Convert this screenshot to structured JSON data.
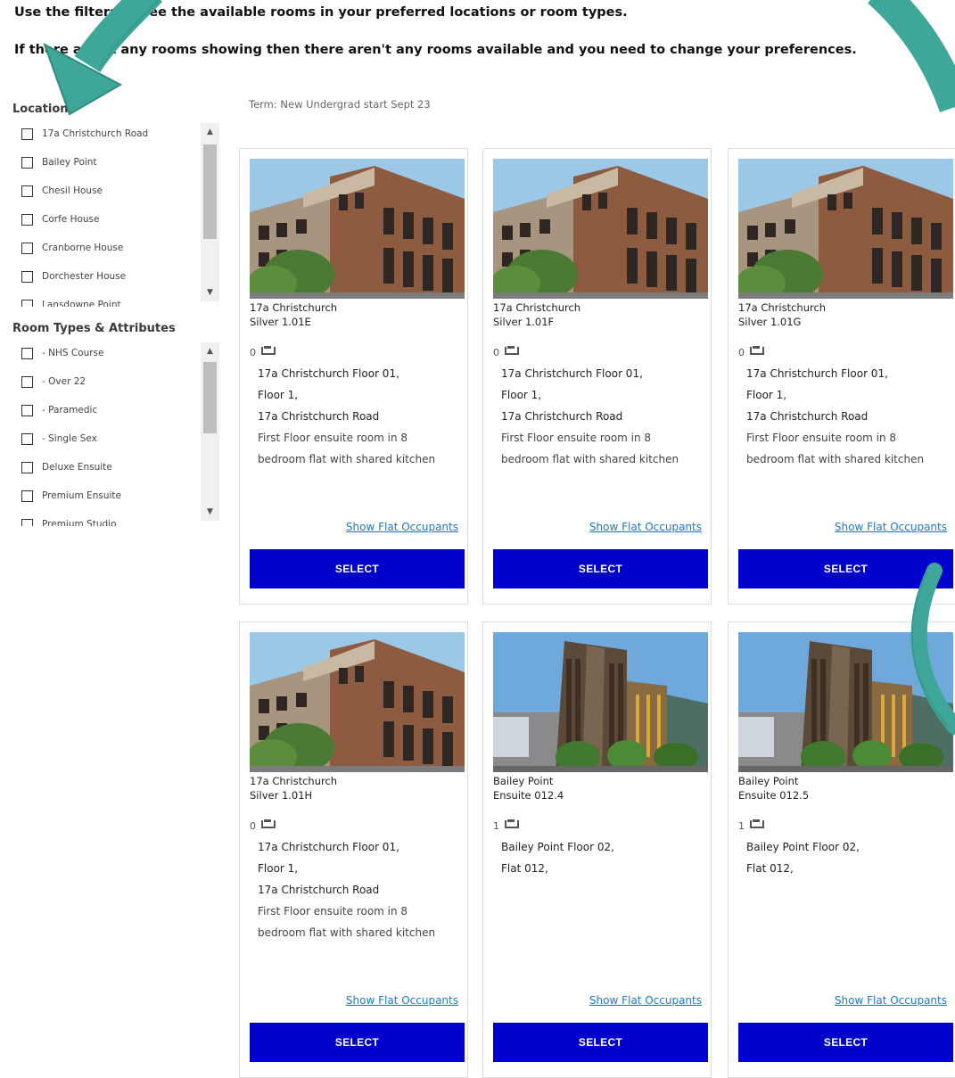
{
  "intro": {
    "line1": "Use the filters to see the available rooms in your preferred locations or room types.",
    "line2": "If there aren't any rooms showing then there aren't any rooms available and you need to change your preferences."
  },
  "sidebar": {
    "locations_heading": "Locations",
    "locations": [
      "17a Christchurch Road",
      "Bailey Point",
      "Chesil House",
      "Corfe House",
      "Cranborne House",
      "Dorchester House",
      "Lansdowne Point"
    ],
    "room_types_heading": "Room Types & Attributes",
    "room_types": [
      "- NHS Course",
      "- Over 22",
      "- Paramedic",
      "- Single Sex",
      "Deluxe Ensuite",
      "Premium Ensuite",
      "Premium Studio"
    ]
  },
  "term": "Term: New Undergrad start Sept 23",
  "rooms": [
    {
      "building": "17a Christchurch",
      "room": "Silver 1.01E",
      "beds": "0",
      "address": [
        "17a Christchurch Floor 01,",
        "Floor 1,",
        "17a Christchurch Road"
      ],
      "description": "First Floor ensuite room in 8 bedroom flat with shared kitchen",
      "link": "Show Flat Occupants",
      "button": "SELECT"
    },
    {
      "building": "17a Christchurch",
      "room": "Silver 1.01F",
      "beds": "0",
      "address": [
        "17a Christchurch Floor 01,",
        "Floor 1,",
        "17a Christchurch Road"
      ],
      "description": "First Floor ensuite room in 8 bedroom flat with shared kitchen",
      "link": "Show Flat Occupants",
      "button": "SELECT"
    },
    {
      "building": "17a Christchurch",
      "room": "Silver 1.01G",
      "beds": "0",
      "address": [
        "17a Christchurch Floor 01,",
        "Floor 1,",
        "17a Christchurch Road"
      ],
      "description": "First Floor ensuite room in 8 bedroom flat with shared kitchen",
      "link": "Show Flat Occupants",
      "button": "SELECT"
    },
    {
      "building": "17a Christchurch",
      "room": "Silver 1.01H",
      "beds": "0",
      "address": [
        "17a Christchurch Floor 01,",
        "Floor 1,",
        "17a Christchurch Road"
      ],
      "description": "First Floor ensuite room in 8 bedroom flat with shared kitchen",
      "link": "Show Flat Occupants",
      "button": "SELECT"
    },
    {
      "building": "Bailey Point",
      "room": "Ensuite 012.4",
      "beds": "1",
      "address": [
        "Bailey Point Floor 02,",
        "Flat 012,"
      ],
      "description": "",
      "link": "Show Flat Occupants",
      "button": "SELECT"
    },
    {
      "building": "Bailey Point",
      "room": "Ensuite 012.5",
      "beds": "1",
      "address": [
        "Bailey Point Floor 02,",
        "Flat 012,"
      ],
      "description": "",
      "link": "Show Flat Occupants",
      "button": "SELECT"
    }
  ],
  "colors": {
    "select_button": "#0000cc",
    "link": "#2277cc",
    "annotation_arrow": "#3fa79a"
  }
}
